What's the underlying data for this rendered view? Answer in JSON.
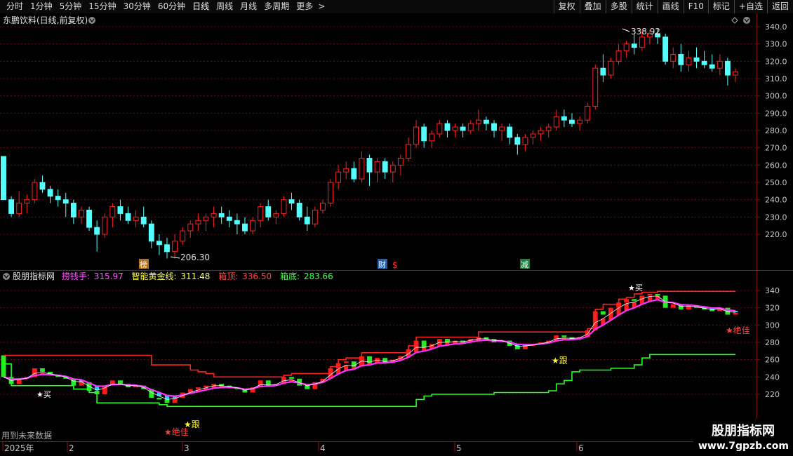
{
  "toolbar": {
    "periods": [
      "分时",
      "1分钟",
      "5分钟",
      "15分钟",
      "30分钟",
      "60分钟",
      "日线",
      "周线",
      "月线",
      "多周期",
      "更多"
    ],
    "active_period": "日线",
    "more_arrow": ">",
    "right_buttons": [
      "复权",
      "叠加",
      "多股",
      "统计",
      "画线",
      "F10",
      "标记",
      "+自选",
      "返回"
    ]
  },
  "main_panel": {
    "title": "东鹏饮料(日线,前复权)",
    "high_marker": "338.92",
    "low_marker": "206.30",
    "event_marks": [
      "榜",
      "财",
      "$",
      "减"
    ],
    "price_axis": [
      "340.0",
      "330.0",
      "320.0",
      "310.0",
      "300.0",
      "290.0",
      "280.0",
      "270.0",
      "260.0",
      "250.0",
      "240.0",
      "230.0",
      "220.0"
    ]
  },
  "indicator_panel": {
    "name": "股朋指标网",
    "values": [
      {
        "label": "捞钱手:",
        "value": "315.97",
        "color": "#ff55ff"
      },
      {
        "label": "智能黄金线:",
        "value": "311.48",
        "color": "#ffff55"
      },
      {
        "label": "箱顶:",
        "value": "336.50",
        "color": "#ff3333"
      },
      {
        "label": "箱底:",
        "value": "283.66",
        "color": "#33ff33"
      }
    ],
    "price_axis": [
      "340",
      "320",
      "300",
      "280",
      "260",
      "240",
      "220"
    ],
    "signals": [
      "★买",
      "★绝佳",
      "★跟",
      "★买",
      "★跟",
      "★绝佳"
    ],
    "future_note": "用到未来数据"
  },
  "date_axis": {
    "labels": [
      "2025年",
      "2",
      "3",
      "4",
      "5",
      "6"
    ]
  },
  "watermark": {
    "title": "股朋指标网",
    "url": "www.7gpzb.com"
  },
  "colors": {
    "up": "#ff2222",
    "down": "#55ffff",
    "grid": "#7a1010",
    "axis_text": "#c8c8c8",
    "box_top": "#ff2222",
    "box_bottom": "#22ff22",
    "money_line": "#ff33ff",
    "gold_line": "#ffff33"
  },
  "chart_data": {
    "type": "candlestick",
    "symbol": "东鹏饮料",
    "ylim": [
      210,
      345
    ],
    "candles": [
      [
        265,
        265,
        255,
        240
      ],
      [
        240,
        242,
        230,
        232
      ],
      [
        232,
        245,
        230,
        238
      ],
      [
        238,
        243,
        232,
        240
      ],
      [
        240,
        252,
        238,
        250
      ],
      [
        250,
        254,
        244,
        246
      ],
      [
        246,
        248,
        238,
        242
      ],
      [
        242,
        246,
        236,
        240
      ],
      [
        240,
        244,
        230,
        238
      ],
      [
        238,
        240,
        226,
        230
      ],
      [
        230,
        236,
        226,
        234
      ],
      [
        234,
        236,
        222,
        224
      ],
      [
        224,
        228,
        210,
        220
      ],
      [
        220,
        232,
        218,
        230
      ],
      [
        230,
        238,
        224,
        236
      ],
      [
        236,
        240,
        228,
        232
      ],
      [
        232,
        236,
        226,
        228
      ],
      [
        228,
        234,
        224,
        230
      ],
      [
        230,
        236,
        224,
        226
      ],
      [
        226,
        228,
        212,
        216
      ],
      [
        216,
        220,
        208,
        214
      ],
      [
        214,
        218,
        206,
        210
      ],
      [
        210,
        220,
        206,
        216
      ],
      [
        216,
        224,
        214,
        222
      ],
      [
        222,
        228,
        218,
        226
      ],
      [
        226,
        232,
        222,
        228
      ],
      [
        228,
        232,
        222,
        230
      ],
      [
        230,
        236,
        224,
        232
      ],
      [
        232,
        236,
        226,
        230
      ],
      [
        230,
        234,
        224,
        228
      ],
      [
        228,
        232,
        220,
        226
      ],
      [
        226,
        230,
        220,
        222
      ],
      [
        222,
        230,
        220,
        228
      ],
      [
        228,
        238,
        224,
        236
      ],
      [
        236,
        240,
        228,
        230
      ],
      [
        230,
        234,
        226,
        232
      ],
      [
        232,
        242,
        230,
        240
      ],
      [
        240,
        244,
        234,
        238
      ],
      [
        238,
        240,
        228,
        230
      ],
      [
        230,
        236,
        222,
        226
      ],
      [
        226,
        236,
        224,
        234
      ],
      [
        234,
        240,
        232,
        238
      ],
      [
        238,
        252,
        236,
        250
      ],
      [
        250,
        260,
        246,
        256
      ],
      [
        256,
        262,
        252,
        258
      ],
      [
        258,
        262,
        250,
        252
      ],
      [
        252,
        268,
        250,
        264
      ],
      [
        264,
        266,
        248,
        256
      ],
      [
        256,
        264,
        250,
        262
      ],
      [
        262,
        264,
        252,
        256
      ],
      [
        256,
        262,
        250,
        260
      ],
      [
        260,
        266,
        254,
        264
      ],
      [
        264,
        276,
        262,
        272
      ],
      [
        272,
        286,
        270,
        282
      ],
      [
        282,
        284,
        270,
        274
      ],
      [
        274,
        280,
        270,
        278
      ],
      [
        278,
        286,
        276,
        284
      ],
      [
        284,
        286,
        276,
        280
      ],
      [
        280,
        284,
        276,
        282
      ],
      [
        282,
        284,
        276,
        280
      ],
      [
        280,
        286,
        278,
        284
      ],
      [
        284,
        292,
        280,
        286
      ],
      [
        286,
        288,
        280,
        284
      ],
      [
        284,
        286,
        276,
        280
      ],
      [
        280,
        284,
        274,
        282
      ],
      [
        282,
        284,
        272,
        276
      ],
      [
        276,
        278,
        266,
        272
      ],
      [
        272,
        278,
        268,
        276
      ],
      [
        276,
        280,
        272,
        278
      ],
      [
        278,
        282,
        274,
        280
      ],
      [
        280,
        284,
        276,
        282
      ],
      [
        282,
        292,
        280,
        288
      ],
      [
        288,
        292,
        282,
        286
      ],
      [
        286,
        290,
        282,
        284
      ],
      [
        284,
        288,
        280,
        286
      ],
      [
        286,
        296,
        284,
        294
      ],
      [
        294,
        318,
        292,
        316
      ],
      [
        316,
        324,
        308,
        312
      ],
      [
        312,
        322,
        310,
        320
      ],
      [
        320,
        330,
        318,
        326
      ],
      [
        326,
        332,
        322,
        330
      ],
      [
        330,
        336,
        324,
        328
      ],
      [
        328,
        338,
        326,
        334
      ],
      [
        334,
        338,
        330,
        336
      ],
      [
        336,
        338.92,
        330,
        334
      ],
      [
        334,
        336,
        318,
        320
      ],
      [
        320,
        328,
        316,
        324
      ],
      [
        324,
        330,
        314,
        318
      ],
      [
        318,
        326,
        314,
        322
      ],
      [
        322,
        328,
        316,
        320
      ],
      [
        320,
        326,
        316,
        318
      ],
      [
        318,
        324,
        314,
        316
      ],
      [
        316,
        324,
        312,
        320
      ],
      [
        320,
        322,
        306,
        312
      ],
      [
        312,
        316,
        308,
        314
      ]
    ],
    "box_top": 336.5,
    "box_bottom": 283.66,
    "money_hand_last": 315.97,
    "gold_line_last": 311.48
  }
}
